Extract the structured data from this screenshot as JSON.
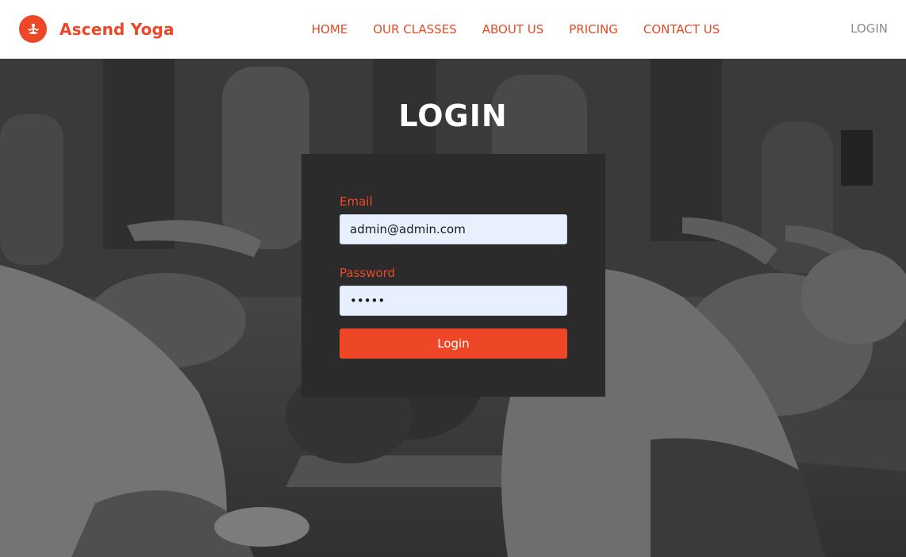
{
  "brand": {
    "name": "Ascend Yoga",
    "logo_icon": "meditation-icon",
    "accent_color": "#ee4727"
  },
  "nav": {
    "items": [
      {
        "label": "HOME"
      },
      {
        "label": "OUR CLASSES"
      },
      {
        "label": "ABOUT US"
      },
      {
        "label": "PRICING"
      },
      {
        "label": "CONTACT US"
      }
    ],
    "login_label": "LOGIN"
  },
  "page": {
    "title": "LOGIN"
  },
  "form": {
    "email_label": "Email",
    "email_value": "admin@admin.com",
    "password_label": "Password",
    "password_value": "•••••",
    "submit_label": "Login"
  },
  "colors": {
    "header_bg": "#ffffff",
    "card_bg": "#2b2b2b",
    "input_bg": "#e8f0fe",
    "nav_login": "#8a8a8a"
  }
}
